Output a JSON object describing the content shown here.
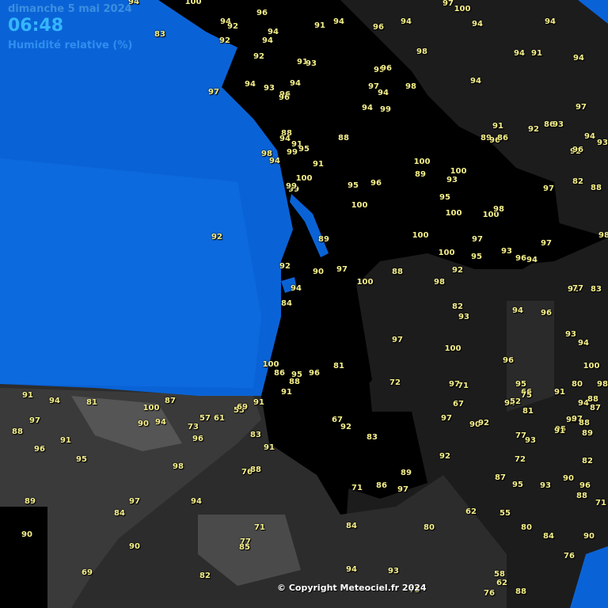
{
  "header": {
    "date": "dimanche 5 mai 2024",
    "time": "06:48",
    "variable": "Humidité relative (%)"
  },
  "copyright": "© Copyright Meteociel.fr 2024",
  "colors": {
    "sea": "#0a63d6",
    "land_high": "#000000",
    "land_mid": "#1c1c1c",
    "land_low": "#3a3a3a",
    "land_lower": "#555555",
    "value_text": "#f6f08a",
    "header_text": "#2a8cff"
  },
  "values": [
    "94",
    "100",
    "96",
    "94",
    "92",
    "94",
    "91",
    "94",
    "96",
    "94",
    "97",
    "100",
    "94",
    "94",
    "83",
    "92",
    "94",
    "92",
    "98",
    "94",
    "91",
    "94",
    "91",
    "93",
    "95",
    "96",
    "98",
    "94",
    "97",
    "94",
    "93",
    "94",
    "96",
    "97",
    "94",
    "96",
    "94",
    "99",
    "97",
    "91",
    "92",
    "86",
    "93",
    "88",
    "94",
    "88",
    "89",
    "96",
    "86",
    "94",
    "93",
    "91",
    "95",
    "99",
    "98",
    "94",
    "91",
    "92",
    "96",
    "100",
    "100",
    "89",
    "100",
    "93",
    "82",
    "88",
    "97",
    "95",
    "96",
    "99",
    "99",
    "100",
    "95",
    "100",
    "100",
    "98",
    "89",
    "100",
    "97",
    "97",
    "98",
    "92",
    "100",
    "95",
    "93",
    "96",
    "94",
    "92",
    "90",
    "97",
    "100",
    "88",
    "92",
    "98",
    "94",
    "84",
    "82",
    "93",
    "94",
    "96",
    "92",
    "77",
    "83",
    "93",
    "94",
    "97",
    "100",
    "96",
    "100",
    "86",
    "95",
    "96",
    "81",
    "88",
    "91",
    "95",
    "66",
    "72",
    "97",
    "71",
    "91",
    "100",
    "98",
    "75",
    "80",
    "94",
    "52",
    "67",
    "81",
    "94",
    "88",
    "87",
    "91",
    "94",
    "81",
    "100",
    "87",
    "57",
    "61",
    "53",
    "69",
    "91",
    "97",
    "88",
    "97",
    "90",
    "94",
    "73",
    "67",
    "92",
    "90",
    "92",
    "94",
    "97",
    "88",
    "95",
    "89",
    "91",
    "96",
    "83",
    "83",
    "77",
    "93",
    "91",
    "96",
    "95",
    "91",
    "92",
    "72",
    "82",
    "98",
    "76",
    "88",
    "89",
    "87",
    "90",
    "89",
    "97",
    "94",
    "84",
    "71",
    "86",
    "97",
    "95",
    "93",
    "96",
    "88",
    "71",
    "62",
    "55",
    "90",
    "90",
    "84",
    "80",
    "80",
    "84",
    "90",
    "76",
    "69",
    "77",
    "85",
    "71",
    "82",
    "94",
    "93",
    "73",
    "76",
    "58",
    "62",
    "88"
  ]
}
